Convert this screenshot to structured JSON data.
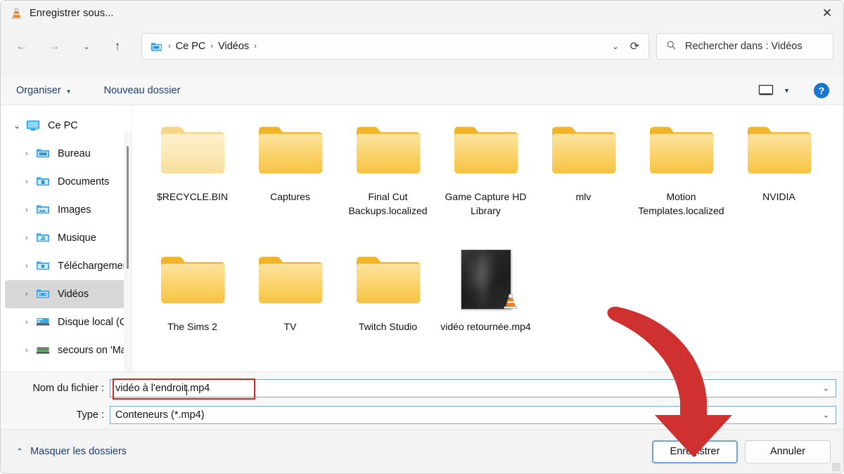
{
  "window": {
    "title": "Enregistrer sous...",
    "app_icon": "vlc-cone-icon",
    "close_label": "✕"
  },
  "nav": {
    "back_icon": "←",
    "forward_icon": "→",
    "history_icon": "⌄",
    "up_icon": "↑",
    "breadcrumb": {
      "folder_icon": "folder-icon",
      "items": [
        "Ce PC",
        "Vidéos"
      ],
      "separator": "›",
      "dropdown_icon": "⌄",
      "refresh_icon": "⟳"
    },
    "search": {
      "icon": "search-icon",
      "placeholder": "Rechercher dans : Vidéos",
      "value": ""
    }
  },
  "toolbar": {
    "organiser_label": "Organiser",
    "organiser_caret": "▼",
    "nouveau_dossier_label": "Nouveau dossier",
    "view_icon": "monitor-icon",
    "view_caret": "▼",
    "help_label": "?"
  },
  "sidebar": {
    "items": [
      {
        "label": "Ce PC",
        "icon": "monitor-icon",
        "chevron": "⌄",
        "expanded": true,
        "depth": 0,
        "selected": false
      },
      {
        "label": "Bureau",
        "icon": "folder-desktop-icon",
        "chevron": "›",
        "expanded": false,
        "depth": 1,
        "selected": false
      },
      {
        "label": "Documents",
        "icon": "folder-documents-icon",
        "chevron": "›",
        "expanded": false,
        "depth": 1,
        "selected": false
      },
      {
        "label": "Images",
        "icon": "folder-pictures-icon",
        "chevron": "›",
        "expanded": false,
        "depth": 1,
        "selected": false
      },
      {
        "label": "Musique",
        "icon": "folder-music-icon",
        "chevron": "›",
        "expanded": false,
        "depth": 1,
        "selected": false
      },
      {
        "label": "Téléchargemen",
        "icon": "folder-downloads-icon",
        "chevron": "›",
        "expanded": false,
        "depth": 1,
        "selected": false
      },
      {
        "label": "Vidéos",
        "icon": "folder-videos-icon",
        "chevron": "›",
        "expanded": false,
        "depth": 1,
        "selected": true
      },
      {
        "label": "Disque local (C:",
        "icon": "drive-icon",
        "chevron": "›",
        "expanded": false,
        "depth": 1,
        "selected": false
      },
      {
        "label": "secours on 'Ma",
        "icon": "network-drive-icon",
        "chevron": "›",
        "expanded": false,
        "depth": 1,
        "selected": false
      }
    ]
  },
  "files": [
    {
      "name": "$RECYCLE.BIN",
      "type": "folder-empty"
    },
    {
      "name": "Captures",
      "type": "folder"
    },
    {
      "name": "Final Cut Backups.localized",
      "type": "folder"
    },
    {
      "name": "Game Capture HD Library",
      "type": "folder"
    },
    {
      "name": "mlv",
      "type": "folder"
    },
    {
      "name": "Motion Templates.localized",
      "type": "folder"
    },
    {
      "name": "NVIDIA",
      "type": "folder"
    },
    {
      "name": "The Sims 2",
      "type": "folder"
    },
    {
      "name": "TV",
      "type": "folder"
    },
    {
      "name": "Twitch Studio",
      "type": "folder"
    },
    {
      "name": "vidéo retournée.mp4",
      "type": "video-thumbnail"
    }
  ],
  "form": {
    "filename_label": "Nom du fichier :",
    "filename_value": "vidéo à l'endroit",
    "filename_value_tail": ".mp4",
    "type_label": "Type :",
    "type_value": "Conteneurs (*.mp4)",
    "combo_arrow": "⌄"
  },
  "footer": {
    "hide_folders_label": "Masquer les dossiers",
    "hide_folders_chevron": "⌃",
    "save_label": "Enregistrer",
    "cancel_label": "Annuler"
  },
  "annotation": {
    "arrow_color": "#cf3030",
    "highlight_color": "#ee1c1c",
    "points_to": "Enregistrer"
  }
}
